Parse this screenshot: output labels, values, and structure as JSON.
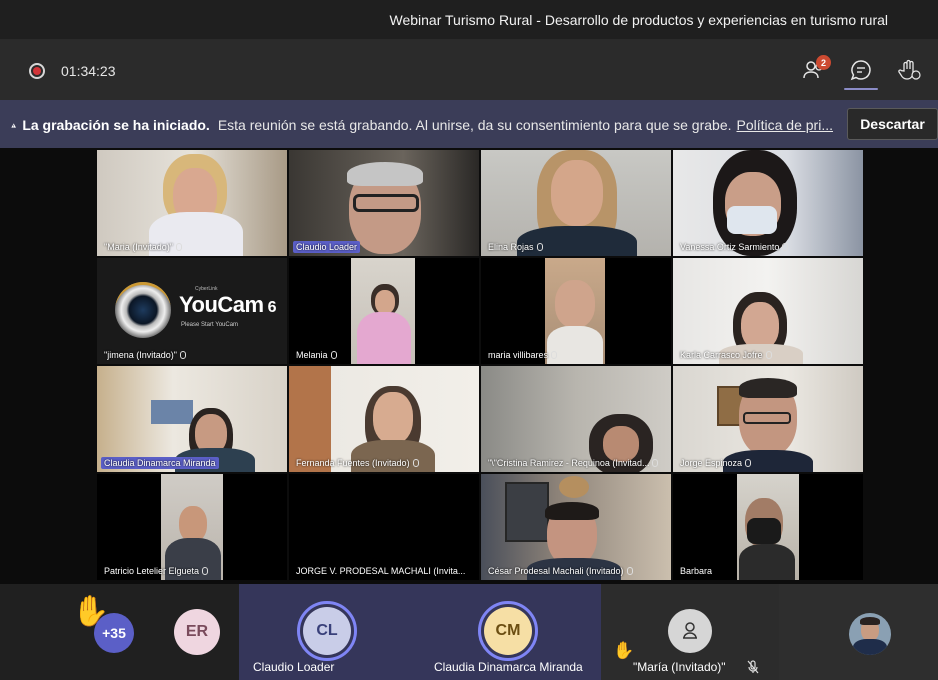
{
  "window": {
    "title": "Webinar Turismo Rural - Desarrollo de productos y experiencias en turismo rural"
  },
  "toolbar": {
    "timer": "01:34:23",
    "participants_count": "2",
    "participants_icon": "people-icon",
    "chat_icon": "chat-icon",
    "reactions_icon": "raise-hand-icon"
  },
  "banner": {
    "title": "La grabación se ha iniciado.",
    "message": "Esta reunión se está grabando. Al unirse, da su consentimiento para que se grabe.",
    "link": "Política de pri...",
    "dismiss": "Descartar"
  },
  "tiles": [
    {
      "name": "\"Maria (Invitado)\"",
      "highlight": false
    },
    {
      "name": "Claudio Loader",
      "highlight": true
    },
    {
      "name": "Elina Rojas",
      "highlight": false
    },
    {
      "name": "Vanessa Ortiz Sarmiento",
      "highlight": false
    },
    {
      "name": "\"jimena (Invitado)\"",
      "highlight": false
    },
    {
      "name": "Melania",
      "highlight": false
    },
    {
      "name": "maria villibares",
      "highlight": false
    },
    {
      "name": "Karla Carrasco Jofre",
      "highlight": false
    },
    {
      "name": "Claudia Dinamarca Miranda",
      "highlight": true
    },
    {
      "name": "Fernanda Fuentes (Invitado)",
      "highlight": false
    },
    {
      "name": "\"\\\"Cristina Ramirez - Requinoa (Invitad...",
      "highlight": false
    },
    {
      "name": "Jorge  Espinoza",
      "highlight": false
    },
    {
      "name": "Patricio Letelier Elgueta",
      "highlight": false
    },
    {
      "name": "JORGE V. PRODESAL MACHALI (Invita...",
      "highlight": false
    },
    {
      "name": "César Prodesal Machali (Invitado)",
      "highlight": false
    },
    {
      "name": "Barbara",
      "highlight": false
    }
  ],
  "youcam": {
    "brand": "CyberLink",
    "product": "YouCam",
    "version": "6",
    "hint": "Please Start YouCam"
  },
  "bottom": {
    "overflow_count": "+35",
    "er_initials": "ER",
    "panel1": {
      "initials": "CL",
      "name": "Claudio Loader"
    },
    "panel2": {
      "initials": "CM",
      "name": "Claudia Dinamarca Miranda"
    },
    "panel3": {
      "name": "\"María (Invitado)\""
    }
  }
}
